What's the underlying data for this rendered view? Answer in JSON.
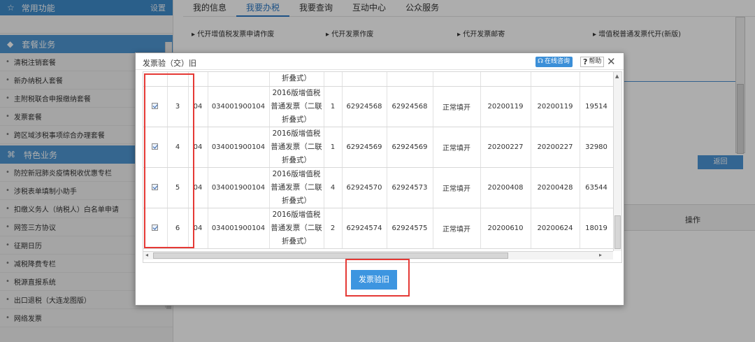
{
  "sidebar": {
    "header": {
      "icon": "star-icon",
      "title": "常用功能",
      "right": "设置"
    },
    "section1": {
      "icon": "package-icon",
      "title": "套餐业务"
    },
    "items1": [
      "清税注销套餐",
      "新办纳税人套餐",
      "主附税联合申报缴纳套餐",
      "发票套餐",
      "跨区域涉税事项综合办理套餐"
    ],
    "section2": {
      "icon": "grid-icon",
      "title": "特色业务"
    },
    "items2": [
      "防控新冠肺炎疫情税收优惠专栏",
      "涉税表单填制小助手",
      "扣缴义务人（纳税人）白名单申请",
      "网签三方协议",
      "征期日历",
      "减税降费专栏",
      "税源直报系统",
      "出口退税（大连龙图版）",
      "网络发票"
    ]
  },
  "topnav": {
    "tabs": [
      "我的信息",
      "我要办税",
      "我要查询",
      "互动中心",
      "公众服务"
    ],
    "active": 1
  },
  "sublinks": [
    "代开增值税发票申请作废",
    "代开发票作废",
    "代开发票邮寄",
    "增值税普通发票代开(新版)"
  ],
  "main": {
    "back_button": "返回",
    "op_header": "操作"
  },
  "dialog": {
    "title": "发票验（交）旧",
    "consult_button": "在线咨询",
    "help_button": "帮助",
    "close": "✕",
    "partial_top": "折叠式）",
    "rows": [
      {
        "checked": true,
        "seq": "3",
        "type_code": "04",
        "code": "034001900104",
        "name_l1": "2016版增值税",
        "name_l2": "普通发票（二联",
        "name_l3": "折叠式）",
        "qty": "1",
        "start_no": "62924568",
        "end_no": "62924568",
        "status": "正常填开",
        "start_date": "20200119",
        "end_date": "20200119",
        "amount": "19514"
      },
      {
        "checked": true,
        "seq": "4",
        "type_code": "04",
        "code": "034001900104",
        "name_l1": "2016版增值税",
        "name_l2": "普通发票（二联",
        "name_l3": "折叠式）",
        "qty": "1",
        "start_no": "62924569",
        "end_no": "62924569",
        "status": "正常填开",
        "start_date": "20200227",
        "end_date": "20200227",
        "amount": "32980"
      },
      {
        "checked": true,
        "seq": "5",
        "type_code": "04",
        "code": "034001900104",
        "name_l1": "2016版增值税",
        "name_l2": "普通发票（二联",
        "name_l3": "折叠式）",
        "qty": "4",
        "start_no": "62924570",
        "end_no": "62924573",
        "status": "正常填开",
        "start_date": "20200408",
        "end_date": "20200428",
        "amount": "63544"
      },
      {
        "checked": true,
        "seq": "6",
        "type_code": "04",
        "code": "034001900104",
        "name_l1": "2016版增值税",
        "name_l2": "普通发票（二联",
        "name_l3": "折叠式）",
        "qty": "2",
        "start_no": "62924574",
        "end_no": "62924575",
        "status": "正常填开",
        "start_date": "20200610",
        "end_date": "20200624",
        "amount": "18019"
      }
    ],
    "submit_button": "发票验旧"
  }
}
